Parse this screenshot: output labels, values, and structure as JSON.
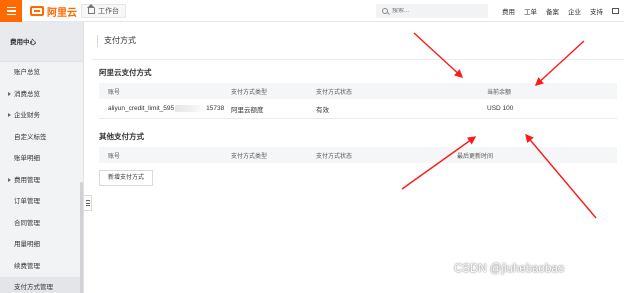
{
  "header": {
    "logo_text": "阿里云",
    "workbench_label": "工作台",
    "search_placeholder": "搜索...",
    "nav": [
      "费用",
      "工单",
      "备案",
      "企业",
      "支持"
    ]
  },
  "sidebar": {
    "title": "费用中心",
    "items": [
      {
        "label": "账户总览",
        "group": false
      },
      {
        "label": "消费总览",
        "group": true
      },
      {
        "label": "企业财务",
        "group": true
      },
      {
        "label": "自定义标签",
        "group": false
      },
      {
        "label": "账单明细",
        "group": false
      },
      {
        "label": "费用管理",
        "group": true
      },
      {
        "label": "订单管理",
        "group": false
      },
      {
        "label": "合同管理",
        "group": false
      },
      {
        "label": "用量明细",
        "group": false
      },
      {
        "label": "续费管理",
        "group": false
      },
      {
        "label": "支付方式管理",
        "group": false
      }
    ]
  },
  "main": {
    "page_title": "支付方式",
    "aliyun_section": {
      "title": "阿里云支付方式",
      "columns": [
        "账号",
        "支付方式类型",
        "支付方式状态",
        "当前余额"
      ],
      "row": {
        "account_prefix": "aliyun_credit_limit_595",
        "account_suffix": "15738",
        "type": "阿里云额度",
        "status": "有效",
        "balance": "USD 100"
      }
    },
    "other_section": {
      "title": "其他支付方式",
      "columns": [
        "账号",
        "支付方式类型",
        "支付方式状态",
        "最后更新时间"
      ],
      "add_button": "新增支付方式"
    }
  },
  "watermark": "CSDN @jiuhebaobao",
  "colors": {
    "brand": "#ff6a00",
    "annotation": "#ff1a1a"
  }
}
